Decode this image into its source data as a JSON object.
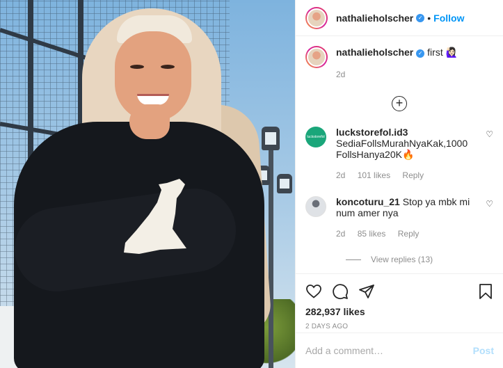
{
  "post": {
    "username": "nathalieholscher",
    "follow_label": "Follow",
    "separator": "•",
    "caption_text": "first 🙋🏻‍♀️",
    "caption_age": "2d"
  },
  "comments": [
    {
      "username": "luckstorefol.id3",
      "text": "SediaFollsMurahNyaKak,1000FollsHanya20K🔥",
      "age": "2d",
      "likes": "101 likes",
      "reply_label": "Reply",
      "avatar_text": "luckstorefol"
    },
    {
      "username": "koncoturu_21",
      "text": "Stop ya mbk minum amer nya",
      "age": "2d",
      "likes": "85 likes",
      "reply_label": "Reply"
    }
  ],
  "view_replies": "View replies (13)",
  "footer": {
    "likes": "282,937 likes",
    "date": "2 DAYS AGO",
    "comment_placeholder": "Add a comment…",
    "post_label": "Post"
  },
  "colors": {
    "link_blue": "#0095f6",
    "post_disabled": "#b2dffc",
    "verified_blue": "#3897f0",
    "muted": "#8e8e8e"
  }
}
